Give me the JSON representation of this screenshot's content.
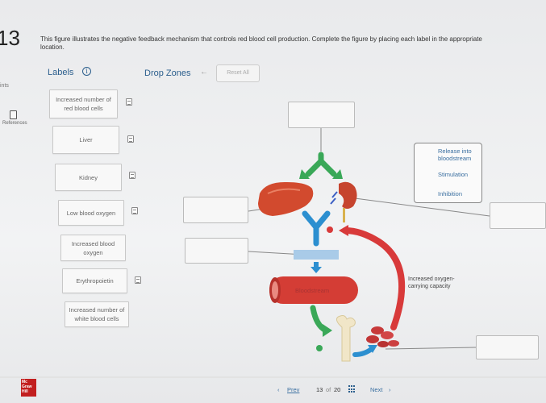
{
  "question": {
    "number": "13",
    "points_label": "ints",
    "references_label": "References",
    "instructions": "This figure illustrates the negative feedback mechanism that controls red blood cell production. Complete the figure by placing each label in the appropriate location."
  },
  "labels_panel": {
    "title": "Labels",
    "info_icon": "info-icon",
    "items": [
      "Increased number of red blood cells",
      "Liver",
      "Kidney",
      "Low blood oxygen",
      "Increased blood oxygen",
      "Erythropoietin",
      "Increased number of white blood cells"
    ]
  },
  "drop_zones": {
    "title": "Drop Zones",
    "reset_label": "Reset All"
  },
  "diagram": {
    "legend": {
      "release": "Release into bloodstream",
      "stimulation": "Stimulation",
      "inhibition": "Inhibition"
    },
    "bloodstream_label": "Bloodstream",
    "capacity_label": "Increased oxygen-carrying capacity",
    "colors": {
      "green": "#3aa858",
      "blue": "#2c8fd0",
      "red": "#d83a3a"
    }
  },
  "navigation": {
    "prev_label": "Prev",
    "page_current": "13",
    "page_of": "of",
    "page_total": "20",
    "next_label": "Next",
    "brand": "Mc Graw Hill"
  }
}
